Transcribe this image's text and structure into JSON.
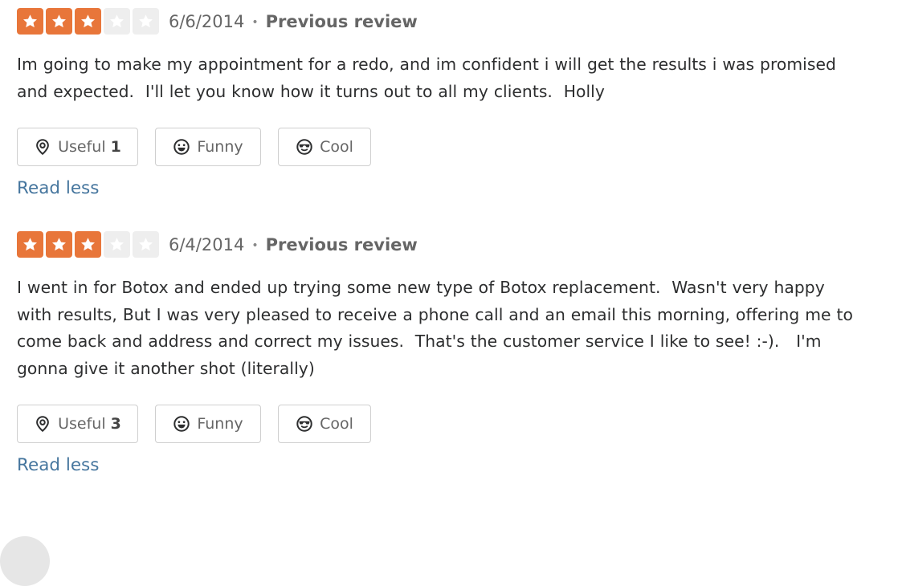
{
  "reviews": [
    {
      "rating": 3,
      "max_rating": 5,
      "date": "6/6/2014",
      "separator": "•",
      "label": "Previous review",
      "text": "Im going to make my appointment for a redo, and im confident i will get the results i was promised\nand expected.  I'll let you know how it turns out to all my clients.  Holly",
      "useful": {
        "label": "Useful",
        "count": "1",
        "icon": "useful-icon"
      },
      "funny": {
        "label": "Funny",
        "icon": "funny-icon"
      },
      "cool": {
        "label": "Cool",
        "icon": "cool-icon"
      },
      "read_less": "Read less"
    },
    {
      "rating": 3,
      "max_rating": 5,
      "date": "6/4/2014",
      "separator": "•",
      "label": "Previous review",
      "text": "I went in for Botox and ended up trying some new type of Botox replacement.  Wasn't very happy\nwith results, But I was very pleased to receive a phone call and an email this morning, offering me to\ncome back and address and correct my issues.  That's the customer service I like to see! :-).   I'm\ngonna give it another shot (literally)",
      "useful": {
        "label": "Useful",
        "count": "3",
        "icon": "useful-icon"
      },
      "funny": {
        "label": "Funny",
        "icon": "funny-icon"
      },
      "cool": {
        "label": "Cool",
        "icon": "cool-icon"
      },
      "read_less": "Read less"
    }
  ],
  "colors": {
    "star_filled": "#e8763a",
    "star_empty": "#eeeeee",
    "link": "#46769e"
  }
}
